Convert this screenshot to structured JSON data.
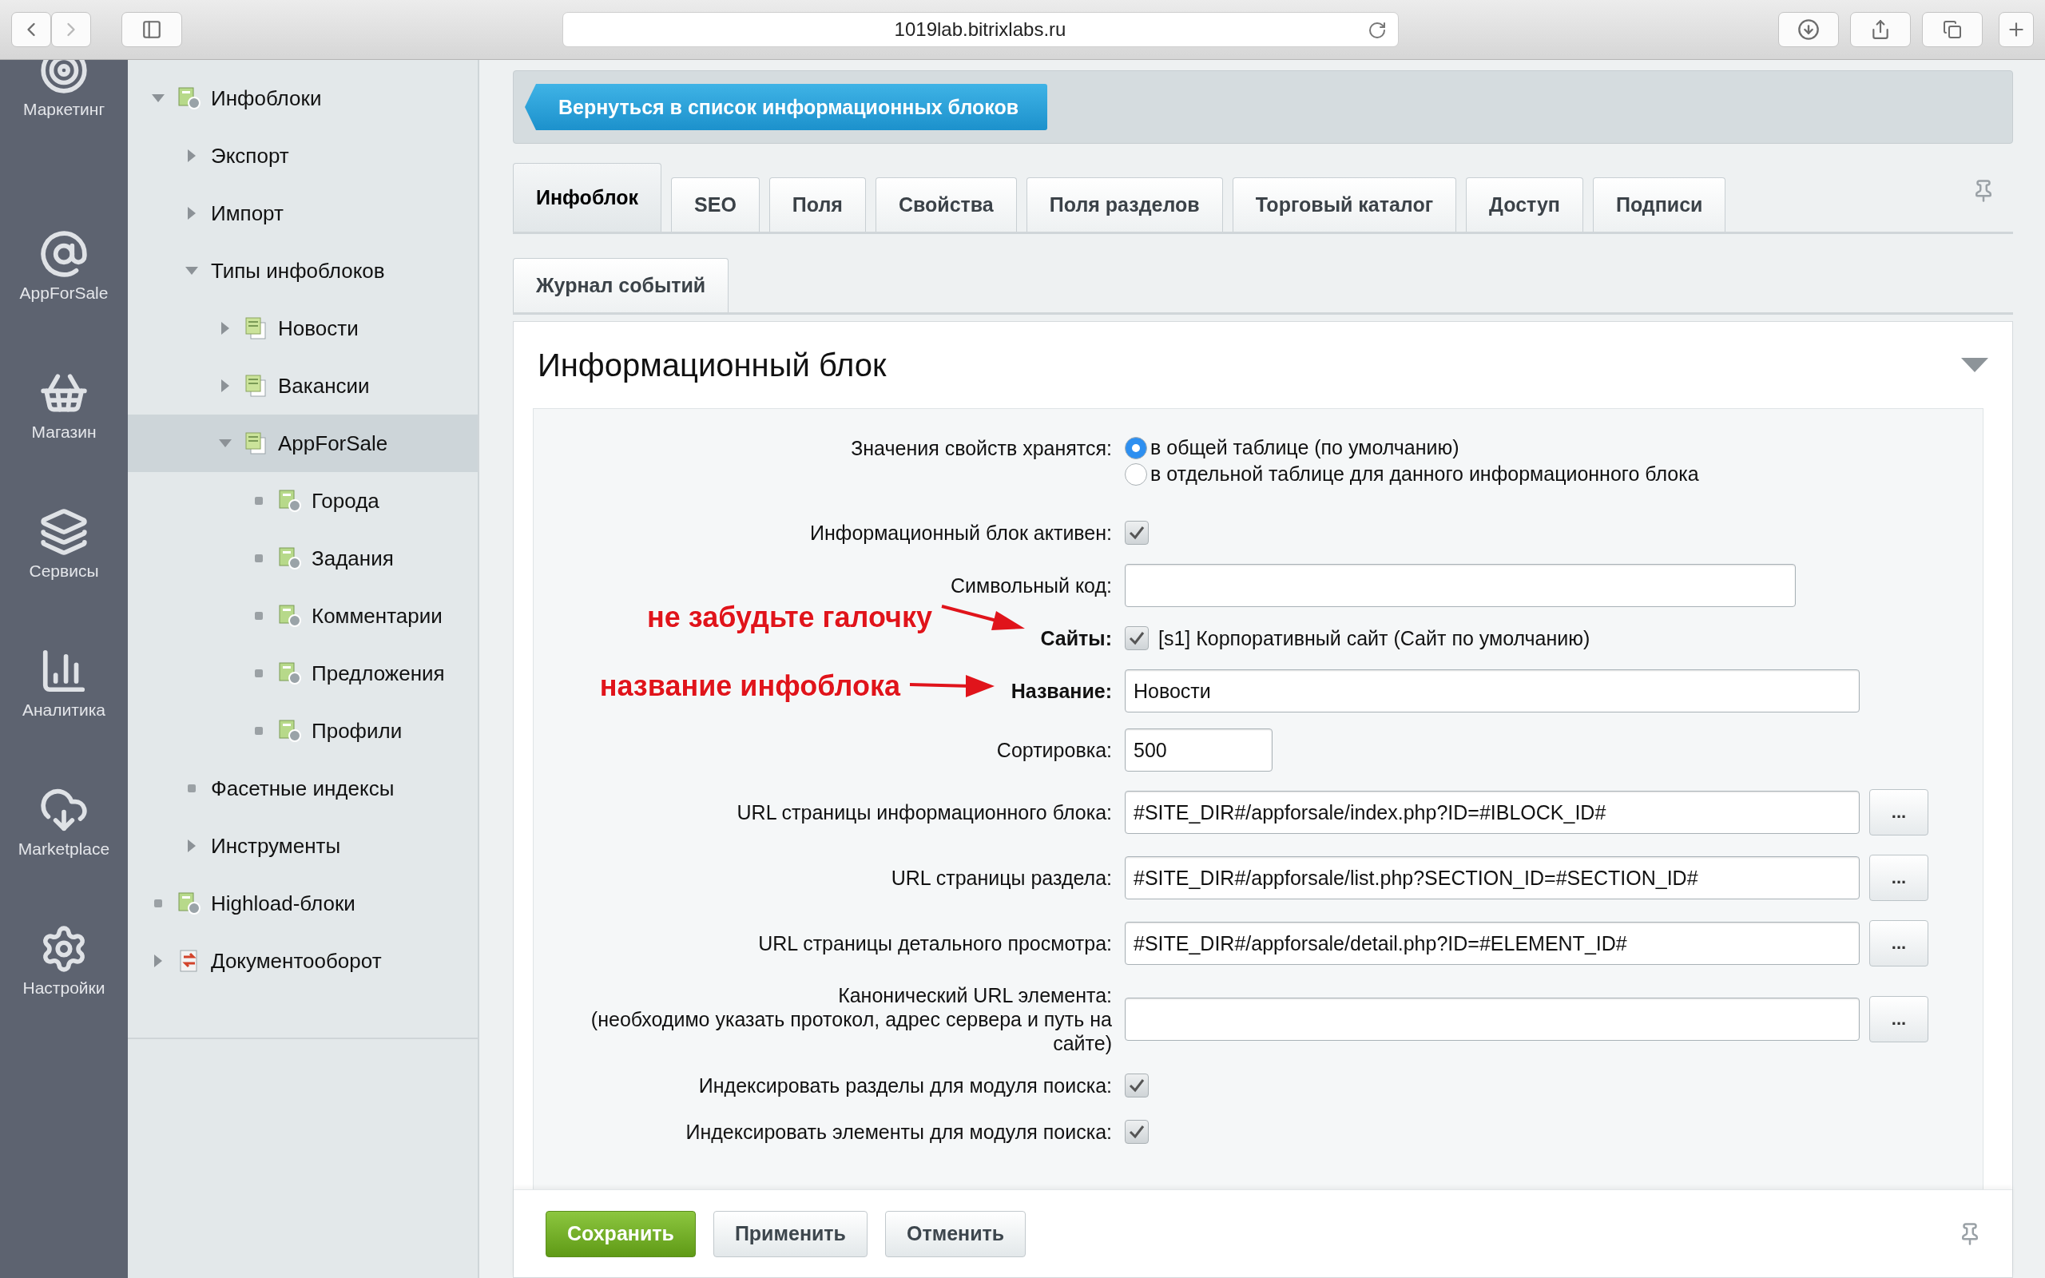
{
  "browser": {
    "url": "1019lab.bitrixlabs.ru"
  },
  "nav": [
    {
      "label": "Маркетинг"
    },
    {
      "label": "AppForSale"
    },
    {
      "label": "Магазин"
    },
    {
      "label": "Сервисы"
    },
    {
      "label": "Аналитика"
    },
    {
      "label": "Marketplace"
    },
    {
      "label": "Настройки"
    }
  ],
  "tree": [
    {
      "label": "Инфоблоки",
      "kind": "iblock",
      "expandable": true,
      "expanded": true,
      "selected": false,
      "children": [
        {
          "label": "Экспорт",
          "expandable": true,
          "expanded": false,
          "selected": false
        },
        {
          "label": "Импорт",
          "expandable": true,
          "expanded": false,
          "selected": false
        },
        {
          "label": "Типы инфоблоков",
          "expandable": true,
          "expanded": true,
          "selected": false,
          "children": [
            {
              "label": "Новости",
              "kind": "type",
              "expandable": true,
              "expanded": false,
              "selected": false
            },
            {
              "label": "Вакансии",
              "kind": "type",
              "expandable": true,
              "expanded": false,
              "selected": false
            },
            {
              "label": "AppForSale",
              "kind": "type",
              "expandable": true,
              "expanded": true,
              "selected": true,
              "children": [
                {
                  "label": "Города",
                  "kind": "iblock",
                  "expandable": false,
                  "selected": false
                },
                {
                  "label": "Задания",
                  "kind": "iblock",
                  "expandable": false,
                  "selected": false
                },
                {
                  "label": "Комментарии",
                  "kind": "iblock",
                  "expandable": false,
                  "selected": false
                },
                {
                  "label": "Предложения",
                  "kind": "iblock",
                  "expandable": false,
                  "selected": false
                },
                {
                  "label": "Профили",
                  "kind": "iblock",
                  "expandable": false,
                  "selected": false
                }
              ]
            }
          ]
        },
        {
          "label": "Фасетные индексы",
          "expandable": false,
          "selected": false
        },
        {
          "label": "Инструменты",
          "expandable": true,
          "expanded": false,
          "selected": false
        }
      ]
    },
    {
      "label": "Highload-блоки",
      "kind": "iblock",
      "expandable": false,
      "selected": false
    },
    {
      "label": "Документооборот",
      "kind": "workflow",
      "expandable": true,
      "expanded": false,
      "selected": false
    }
  ],
  "back_button": "Вернуться в список информационных блоков",
  "tab_rows": [
    [
      {
        "label": "Инфоблок",
        "selected": true
      },
      {
        "label": "SEO",
        "selected": false
      },
      {
        "label": "Поля",
        "selected": false
      },
      {
        "label": "Свойства",
        "selected": false
      },
      {
        "label": "Поля разделов",
        "selected": false
      },
      {
        "label": "Торговый каталог",
        "selected": false
      },
      {
        "label": "Доступ",
        "selected": false
      },
      {
        "label": "Подписи",
        "selected": false
      }
    ],
    [
      {
        "label": "Журнал событий",
        "selected": false
      }
    ]
  ],
  "section": {
    "title": "Информационный блок",
    "expanded": true
  },
  "fields": [
    {
      "kind": "radio",
      "label": "Значения свойств хранятся:",
      "required": false,
      "options": [
        {
          "label": "в общей таблице (по умолчанию)",
          "selected": true
        },
        {
          "label": "в отдельной таблице для данного информационного блока",
          "selected": false
        }
      ]
    },
    {
      "kind": "checkbox",
      "label": "Информационный блок активен:",
      "required": false,
      "checked": true
    },
    {
      "kind": "input",
      "label": "Символьный код:",
      "required": false
    },
    {
      "kind": "checkbox",
      "label": "Сайты:",
      "required": true,
      "checked": true,
      "text": "[s1] Корпоративный сайт (Сайт по умолчанию)",
      "annotation": "не забудьте галочку"
    },
    {
      "kind": "input",
      "label": "Название:",
      "required": true,
      "value": "Новости",
      "annotation": "название инфоблока"
    },
    {
      "kind": "input",
      "label": "Сортировка:",
      "required": false,
      "value": "500"
    },
    {
      "kind": "browse",
      "label": "URL страницы информационного блока:",
      "required": false,
      "value": "#SITE_DIR#/appforsale/index.php?ID=#IBLOCK_ID#",
      "button": "..."
    },
    {
      "kind": "browse",
      "label": "URL страницы раздела:",
      "required": false,
      "value": "#SITE_DIR#/appforsale/list.php?SECTION_ID=#SECTION_ID#",
      "button": "..."
    },
    {
      "kind": "browse",
      "label": "URL страницы детального просмотра:",
      "required": false,
      "value": "#SITE_DIR#/appforsale/detail.php?ID=#ELEMENT_ID#",
      "button": "..."
    },
    {
      "kind": "browse",
      "label": "Канонический URL элемента:",
      "note": "(необходимо указать протокол, адрес сервера и путь на сайте)",
      "required": false,
      "button": "..."
    },
    {
      "kind": "checkbox",
      "label": "Индексировать разделы для модуля поиска:",
      "required": false,
      "checked": true
    },
    {
      "kind": "checkbox",
      "label": "Индексировать элементы для модуля поиска:",
      "required": false,
      "checked": true
    }
  ],
  "footer_buttons": [
    {
      "label": "Сохранить",
      "kind": "primary"
    },
    {
      "label": "Применить",
      "kind": "default"
    },
    {
      "label": "Отменить",
      "kind": "default"
    }
  ]
}
